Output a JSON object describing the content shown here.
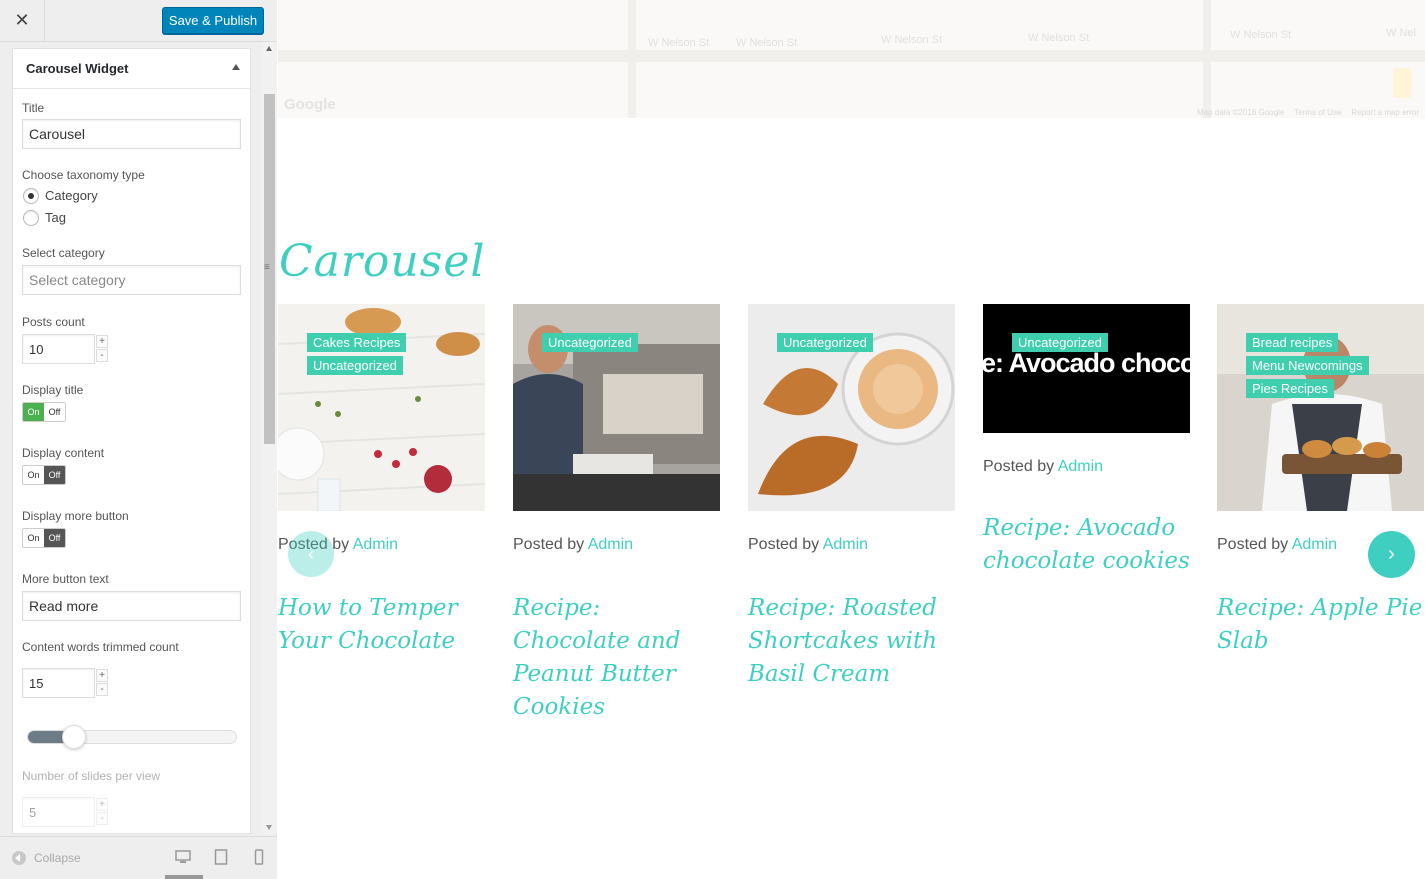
{
  "topbar": {
    "close_glyph": "✕",
    "publish_label": "Save & Publish"
  },
  "widget": {
    "header": "Carousel Widget",
    "title_label": "Title",
    "title_value": "Carousel",
    "taxonomy_label": "Choose taxonomy type",
    "taxonomy_options": [
      "Category",
      "Tag"
    ],
    "taxonomy_selected": "Category",
    "category_label": "Select category",
    "category_placeholder": "Select category",
    "posts_count_label": "Posts count",
    "posts_count_value": "10",
    "display_title_label": "Display title",
    "display_content_label": "Display content",
    "display_more_label": "Display more button",
    "toggle_on": "On",
    "toggle_off": "Off",
    "display_title_state": "On",
    "display_content_state": "Off",
    "display_more_state": "Off",
    "more_text_label": "More button text",
    "more_text_value": "Read more",
    "trim_label": "Content words trimmed count",
    "trim_value": "15",
    "slider_fraction": 0.22,
    "slides_label": "Number of slides per view",
    "slides_value": "5",
    "spinner_up": "+",
    "spinner_down": "-"
  },
  "footer": {
    "collapse_label": "Collapse",
    "devices": [
      "desktop-icon",
      "tablet-icon",
      "mobile-icon"
    ]
  },
  "map": {
    "streets": [
      "W Nelson St",
      "W Nelson St",
      "W Nelson St",
      "W Nelson St",
      "W Nelson St",
      "W Nel"
    ],
    "google": "Google",
    "map_data": "Map data ©2016 Google",
    "terms": "Terms of Use",
    "report": "Report a map error"
  },
  "carousel": {
    "heading": "Carousel",
    "posted_by": "Posted by",
    "author": "Admin",
    "prev_glyph": "‹",
    "next_glyph": "›",
    "cards": [
      {
        "tags": [
          "Cakes Recipes",
          "Uncategorized"
        ],
        "title": "How to Temper Your Chocolate",
        "image": "pastries-table-photo"
      },
      {
        "tags": [
          "Uncategorized"
        ],
        "title": "Recipe: Chocolate and Peanut Butter Cookies",
        "image": "barista-photo"
      },
      {
        "tags": [
          "Uncategorized"
        ],
        "title": "Recipe: Roasted Shortcakes with Basil Cream",
        "image": "croissant-coffee-photo"
      },
      {
        "tags": [
          "Uncategorized"
        ],
        "title": "Recipe: Avocado chocolate cookies",
        "image_text": "e: Avocado chocolate c"
      },
      {
        "tags": [
          "Bread recipes",
          "Menu Newcomings",
          "Pies Recipes"
        ],
        "title": "Recipe: Apple Pie Slab",
        "image": "baker-tray-photo"
      }
    ]
  },
  "colors": {
    "accent": "#3fcfc1",
    "tag": "#3fcfaf",
    "publish": "#0085ba"
  }
}
